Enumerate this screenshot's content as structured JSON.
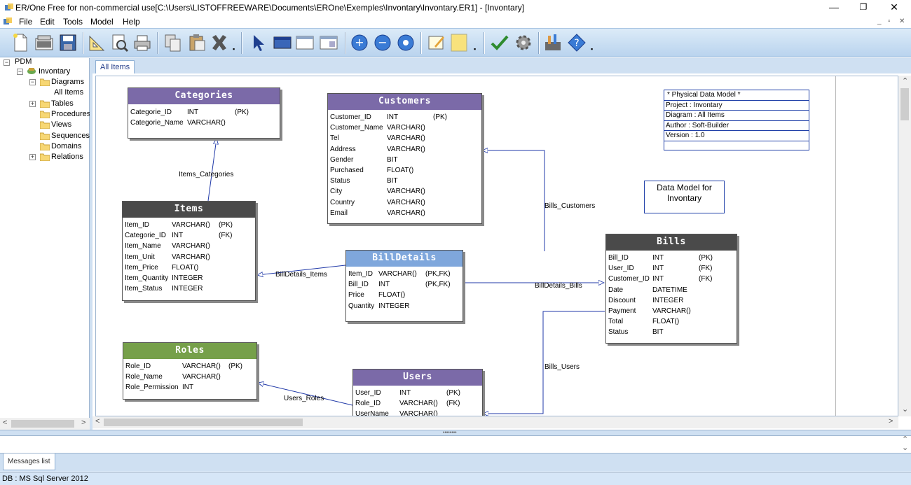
{
  "window": {
    "title": "ER/One Free for non-commercial use[C:\\Users\\LISTOFFREEWARE\\Documents\\EROne\\Exemples\\Invontary\\Invontary.ER1] - [Invontary]",
    "minimize": "—",
    "restore": "❐",
    "close": "✕"
  },
  "menubar": {
    "items": [
      "File",
      "Edit",
      "Tools",
      "Model",
      "Help"
    ],
    "mdi_controls": [
      "_",
      "▫",
      "✕"
    ]
  },
  "toolbar": {
    "icons": [
      "new-file-icon",
      "open-icon",
      "save-icon",
      "ruler-icon",
      "print-preview-icon",
      "print-icon",
      "copy-icon",
      "paste-icon",
      "delete-icon",
      "pointer-icon",
      "table-icon",
      "view-icon",
      "window-icon",
      "zoom-in-icon",
      "zoom-out-icon",
      "zoom-fit-icon",
      "note-icon",
      "page-icon",
      "check-icon",
      "gear-icon",
      "tools-icon",
      "help-icon"
    ]
  },
  "tree": {
    "root": "PDM",
    "project": "Invontary",
    "diagrams": "Diagrams",
    "all_items": "All Items",
    "tables": "Tables",
    "procedures": "Procedures",
    "views": "Views",
    "sequences": "Sequences",
    "domains": "Domains",
    "relations": "Relations"
  },
  "tabs": {
    "active": "All Items"
  },
  "entities": {
    "categories": {
      "name": "Categories",
      "color": "#7b6aa8",
      "rows": [
        [
          "Categorie_ID",
          "INT",
          "(PK)"
        ],
        [
          "Categorie_Name",
          "VARCHAR()",
          ""
        ]
      ]
    },
    "customers": {
      "name": "Customers",
      "color": "#7b6aa8",
      "rows": [
        [
          "Customer_ID",
          "INT",
          "(PK)"
        ],
        [
          "Customer_Name",
          "VARCHAR()",
          ""
        ],
        [
          "Tel",
          "VARCHAR()",
          ""
        ],
        [
          "Address",
          "VARCHAR()",
          ""
        ],
        [
          "Gender",
          "BIT",
          ""
        ],
        [
          "Purchased",
          "FLOAT()",
          ""
        ],
        [
          "Status",
          "BIT",
          ""
        ],
        [
          "City",
          "VARCHAR()",
          ""
        ],
        [
          "Country",
          "VARCHAR()",
          ""
        ],
        [
          "Email",
          "VARCHAR()",
          ""
        ]
      ]
    },
    "items": {
      "name": "Items",
      "color": "#4a4a4a",
      "rows": [
        [
          "Item_ID",
          "VARCHAR()",
          "(PK)"
        ],
        [
          "Categorie_ID",
          "INT",
          "(FK)"
        ],
        [
          "Item_Name",
          "VARCHAR()",
          ""
        ],
        [
          "Item_Unit",
          "VARCHAR()",
          ""
        ],
        [
          "Item_Price",
          "FLOAT()",
          ""
        ],
        [
          "Item_Quantity",
          "INTEGER",
          ""
        ],
        [
          "Item_Status",
          "INTEGER",
          ""
        ]
      ]
    },
    "billdetails": {
      "name": "BillDetails",
      "color": "#7fa7dc",
      "rows": [
        [
          "Item_ID",
          "VARCHAR()",
          "(PK,FK)"
        ],
        [
          "Bill_ID",
          "INT",
          "(PK,FK)"
        ],
        [
          "Price",
          "FLOAT()",
          ""
        ],
        [
          "Quantity",
          "INTEGER",
          ""
        ]
      ]
    },
    "bills": {
      "name": "Bills",
      "color": "#4a4a4a",
      "rows": [
        [
          "Bill_ID",
          "INT",
          "(PK)"
        ],
        [
          "User_ID",
          "INT",
          "(FK)"
        ],
        [
          "Customer_ID",
          "INT",
          "(FK)"
        ],
        [
          "Date",
          "DATETIME",
          ""
        ],
        [
          "Discount",
          "INTEGER",
          ""
        ],
        [
          "Payment",
          "VARCHAR()",
          ""
        ],
        [
          "Total",
          "FLOAT()",
          ""
        ],
        [
          "Status",
          "BIT",
          ""
        ]
      ]
    },
    "roles": {
      "name": "Roles",
      "color": "#76a04a",
      "rows": [
        [
          "Role_ID",
          "VARCHAR()",
          "(PK)"
        ],
        [
          "Role_Name",
          "VARCHAR()",
          ""
        ],
        [
          "Role_Permission",
          "INT",
          ""
        ]
      ]
    },
    "users": {
      "name": "Users",
      "color": "#7b6aa8",
      "rows": [
        [
          "User_ID",
          "INT",
          "(PK)"
        ],
        [
          "Role_ID",
          "VARCHAR()",
          "(FK)"
        ],
        [
          "UserName",
          "VARCHAR()",
          ""
        ]
      ]
    }
  },
  "relations": {
    "items_categories": "Items_Categories",
    "bills_customers": "Bills_Customers",
    "billdetails_items": "BillDetails_Items",
    "billdetails_bills": "BillDetails_Bills",
    "bills_users": "Bills_Users",
    "users_roles": "Users_Roles"
  },
  "info": {
    "lines": [
      "* Physical Data Model *",
      "Project : Invontary",
      "Diagram : All Items",
      "Author : Soft-Builder",
      "Version : 1.0"
    ]
  },
  "note": {
    "text": "Data Model for Invontary"
  },
  "bottom": {
    "messages_tab": "Messages list",
    "status": "DB : MS Sql Server 2012"
  },
  "colors": {
    "accent": "#1f3fa8",
    "panel": "#cfe0f2"
  }
}
